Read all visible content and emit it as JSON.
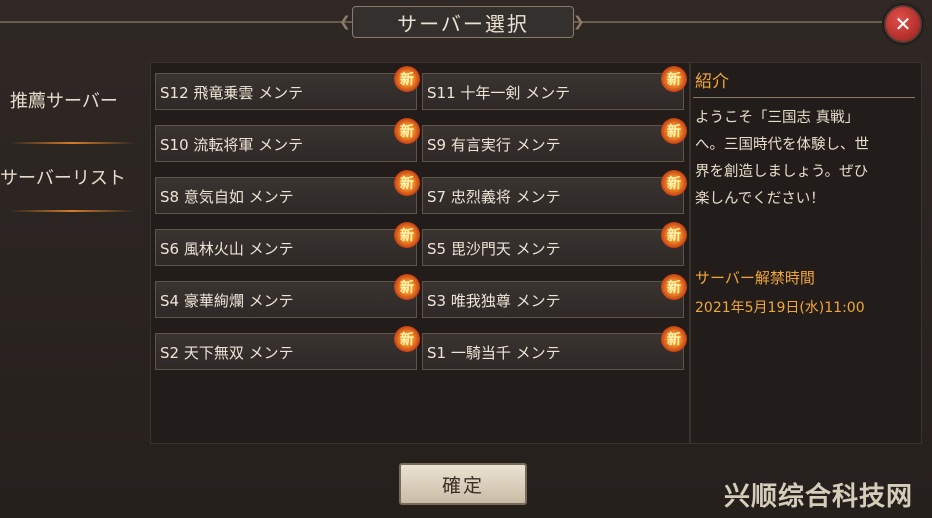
{
  "dialog": {
    "title": "サーバー選択",
    "close_icon": "close-x-icon",
    "confirm_label": "確定"
  },
  "nav": {
    "recommended": "推薦サーバー",
    "server_list": "サーバーリスト"
  },
  "servers": [
    {
      "label": "S12 飛竜乗雲 メンテ",
      "badge": "新"
    },
    {
      "label": "S11 十年一剣 メンテ",
      "badge": "新"
    },
    {
      "label": "S10 流転将軍 メンテ",
      "badge": "新"
    },
    {
      "label": "S9 有言実行 メンテ",
      "badge": "新"
    },
    {
      "label": "S8 意気自如 メンテ",
      "badge": "新"
    },
    {
      "label": "S7 忠烈義将 メンテ",
      "badge": "新"
    },
    {
      "label": "S6 風林火山 メンテ",
      "badge": "新"
    },
    {
      "label": "S5 毘沙門天 メンテ",
      "badge": "新"
    },
    {
      "label": "S4 豪華絢爛 メンテ",
      "badge": "新"
    },
    {
      "label": "S3 唯我独尊 メンテ",
      "badge": "新"
    },
    {
      "label": "S2 天下無双 メンテ",
      "badge": "新"
    },
    {
      "label": "S1 一騎当千 メンテ",
      "badge": "新"
    }
  ],
  "info": {
    "title": "紹介",
    "text": "ようこそ「三国志 真戦」\nへ。三国時代を体験し、世\n界を創造しましょう。ぜひ\n楽しんでください！",
    "lift_title": "サーバー解禁時間",
    "lift_time": "2021年5月19日(水)11:00"
  },
  "watermark": "兴顺综合科技网",
  "colors": {
    "accent": "#f0a63a",
    "background": "#2a2421",
    "close": "#c8302a"
  }
}
